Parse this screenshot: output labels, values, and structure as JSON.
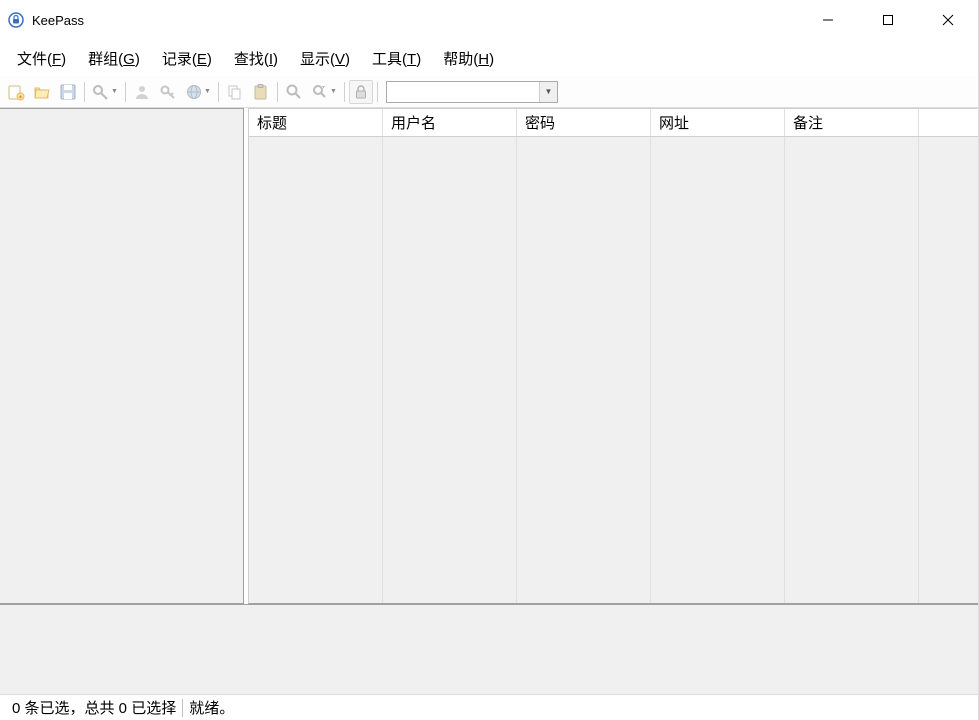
{
  "titlebar": {
    "title": "KeePass"
  },
  "menu": {
    "file": "文件(F)",
    "group": "群组(G)",
    "entry": "记录(E)",
    "find": "查找(I)",
    "view": "显示(V)",
    "tools": "工具(T)",
    "help": "帮助(H)"
  },
  "columns": {
    "title": "标题",
    "username": "用户名",
    "password": "密码",
    "url": "网址",
    "notes": "备注"
  },
  "status": {
    "selection": "0 条已选，总共 0 已选择",
    "ready": "就绪。"
  }
}
